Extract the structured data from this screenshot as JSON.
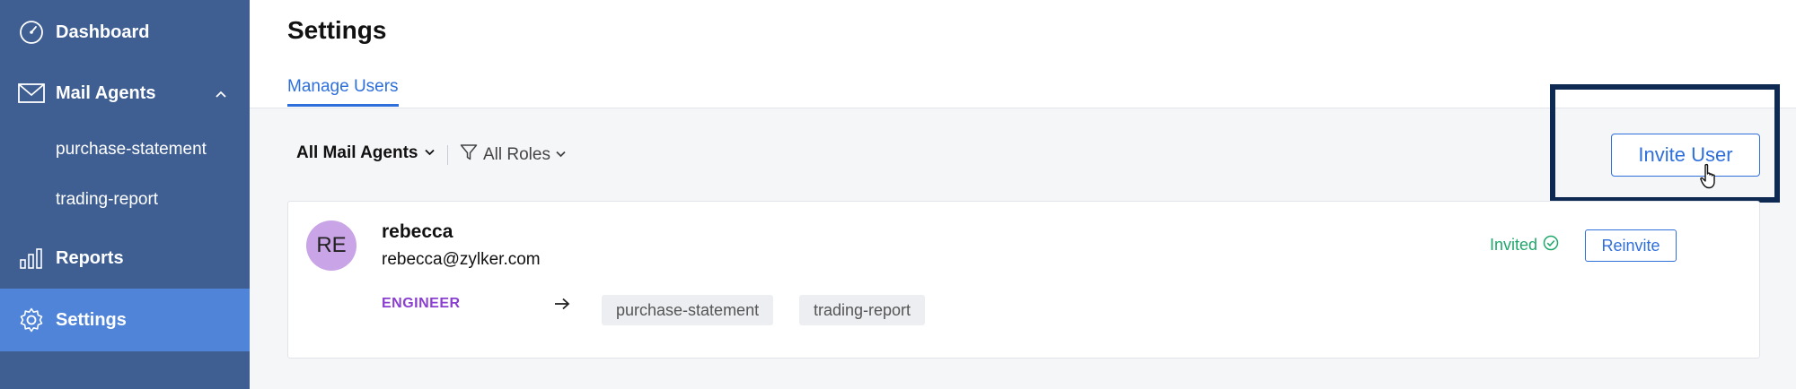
{
  "sidebar": {
    "items": [
      {
        "label": "Dashboard",
        "icon": "dashboard-gauge-icon"
      },
      {
        "label": "Mail Agents",
        "icon": "mail-envelope-icon",
        "expanded": true
      },
      {
        "label": "purchase-statement"
      },
      {
        "label": "trading-report"
      },
      {
        "label": "Reports",
        "icon": "bar-chart-icon"
      },
      {
        "label": "Settings",
        "icon": "gear-icon",
        "active": true
      }
    ]
  },
  "header": {
    "title": "Settings",
    "tabs": [
      {
        "label": "Manage Users"
      }
    ]
  },
  "filters": {
    "mail_agents": "All Mail Agents",
    "roles": "All Roles"
  },
  "actions": {
    "invite_label": "Invite User"
  },
  "users": [
    {
      "initials": "RE",
      "name": "rebecca",
      "email": "rebecca@zylker.com",
      "role": "ENGINEER",
      "agents": [
        "purchase-statement",
        "trading-report"
      ],
      "status": "Invited",
      "action_label": "Reinvite"
    }
  ],
  "colors": {
    "sidebar_bg": "#3f5f92",
    "sidebar_active": "#5084d8",
    "accent": "#2e6fdc",
    "status_invited": "#1fa86b",
    "role_engineer": "#8a3fd1",
    "avatar_bg": "#c9a4e6",
    "highlight_frame": "#0e2a52"
  }
}
